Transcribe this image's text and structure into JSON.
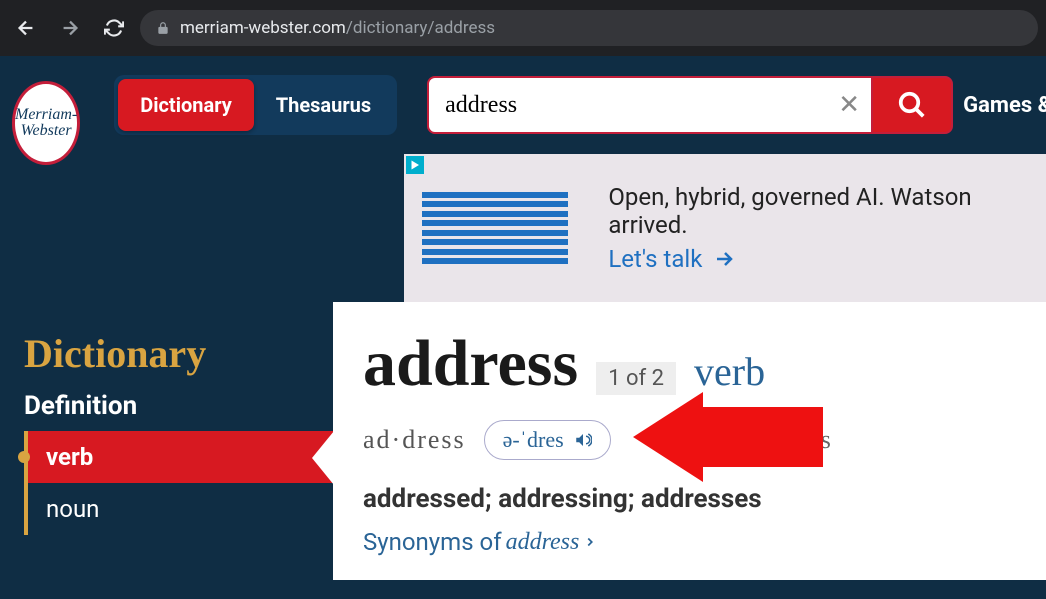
{
  "browser": {
    "url_domain": "merriam-webster.com",
    "url_path": "/dictionary/address"
  },
  "logo": {
    "line1": "Merriam-",
    "line2": "Webster"
  },
  "header": {
    "toggle_dictionary": "Dictionary",
    "toggle_thesaurus": "Thesaurus",
    "search_value": "address",
    "games_label": "Games &"
  },
  "ad": {
    "text": "Open, hybrid, governed AI. Watson arrived.",
    "cta": "Let's talk"
  },
  "sidebar": {
    "title": "Dictionary",
    "subtitle": "Definition",
    "items": [
      {
        "label": "verb",
        "active": true
      },
      {
        "label": "noun",
        "active": false
      }
    ]
  },
  "entry": {
    "headword": "address",
    "entry_num": "1 of 2",
    "pos": "verb",
    "syllables": "ad·dress",
    "pron_pill": "ə-ˈdres",
    "pron_alt": "a-ˌdres",
    "forms": "addressed; addressing; addresses",
    "syn_prefix": "Synonyms of ",
    "syn_word": "address"
  },
  "colors": {
    "brand_red": "#d71921",
    "brand_navy": "#0f2d44",
    "brand_gold": "#d9a441",
    "link_blue": "#2a6496"
  }
}
